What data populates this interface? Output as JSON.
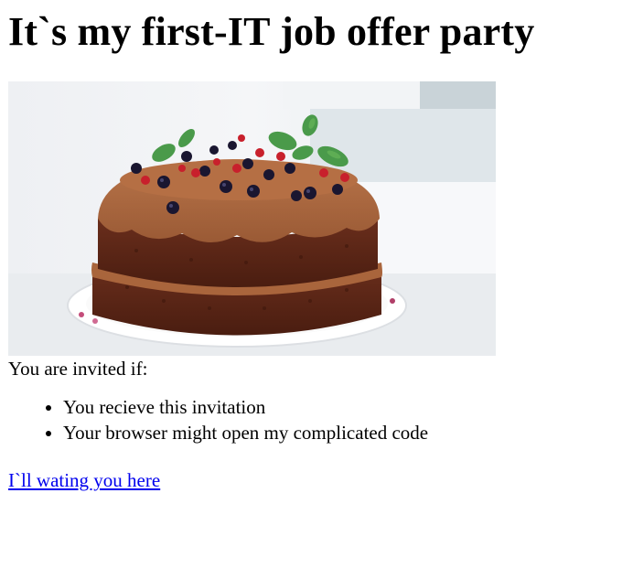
{
  "page": {
    "heading": "It`s my first-IT job offer party",
    "image_alt": "Chocolate cake with berries and mint",
    "intro": "You are invited if:",
    "conditions": [
      "You recieve this invitation",
      "Your browser might open my complicated code"
    ],
    "link_text": "I`ll wating you here"
  },
  "colors": {
    "link": "#0000ee",
    "text": "#000000",
    "background": "#ffffff"
  }
}
